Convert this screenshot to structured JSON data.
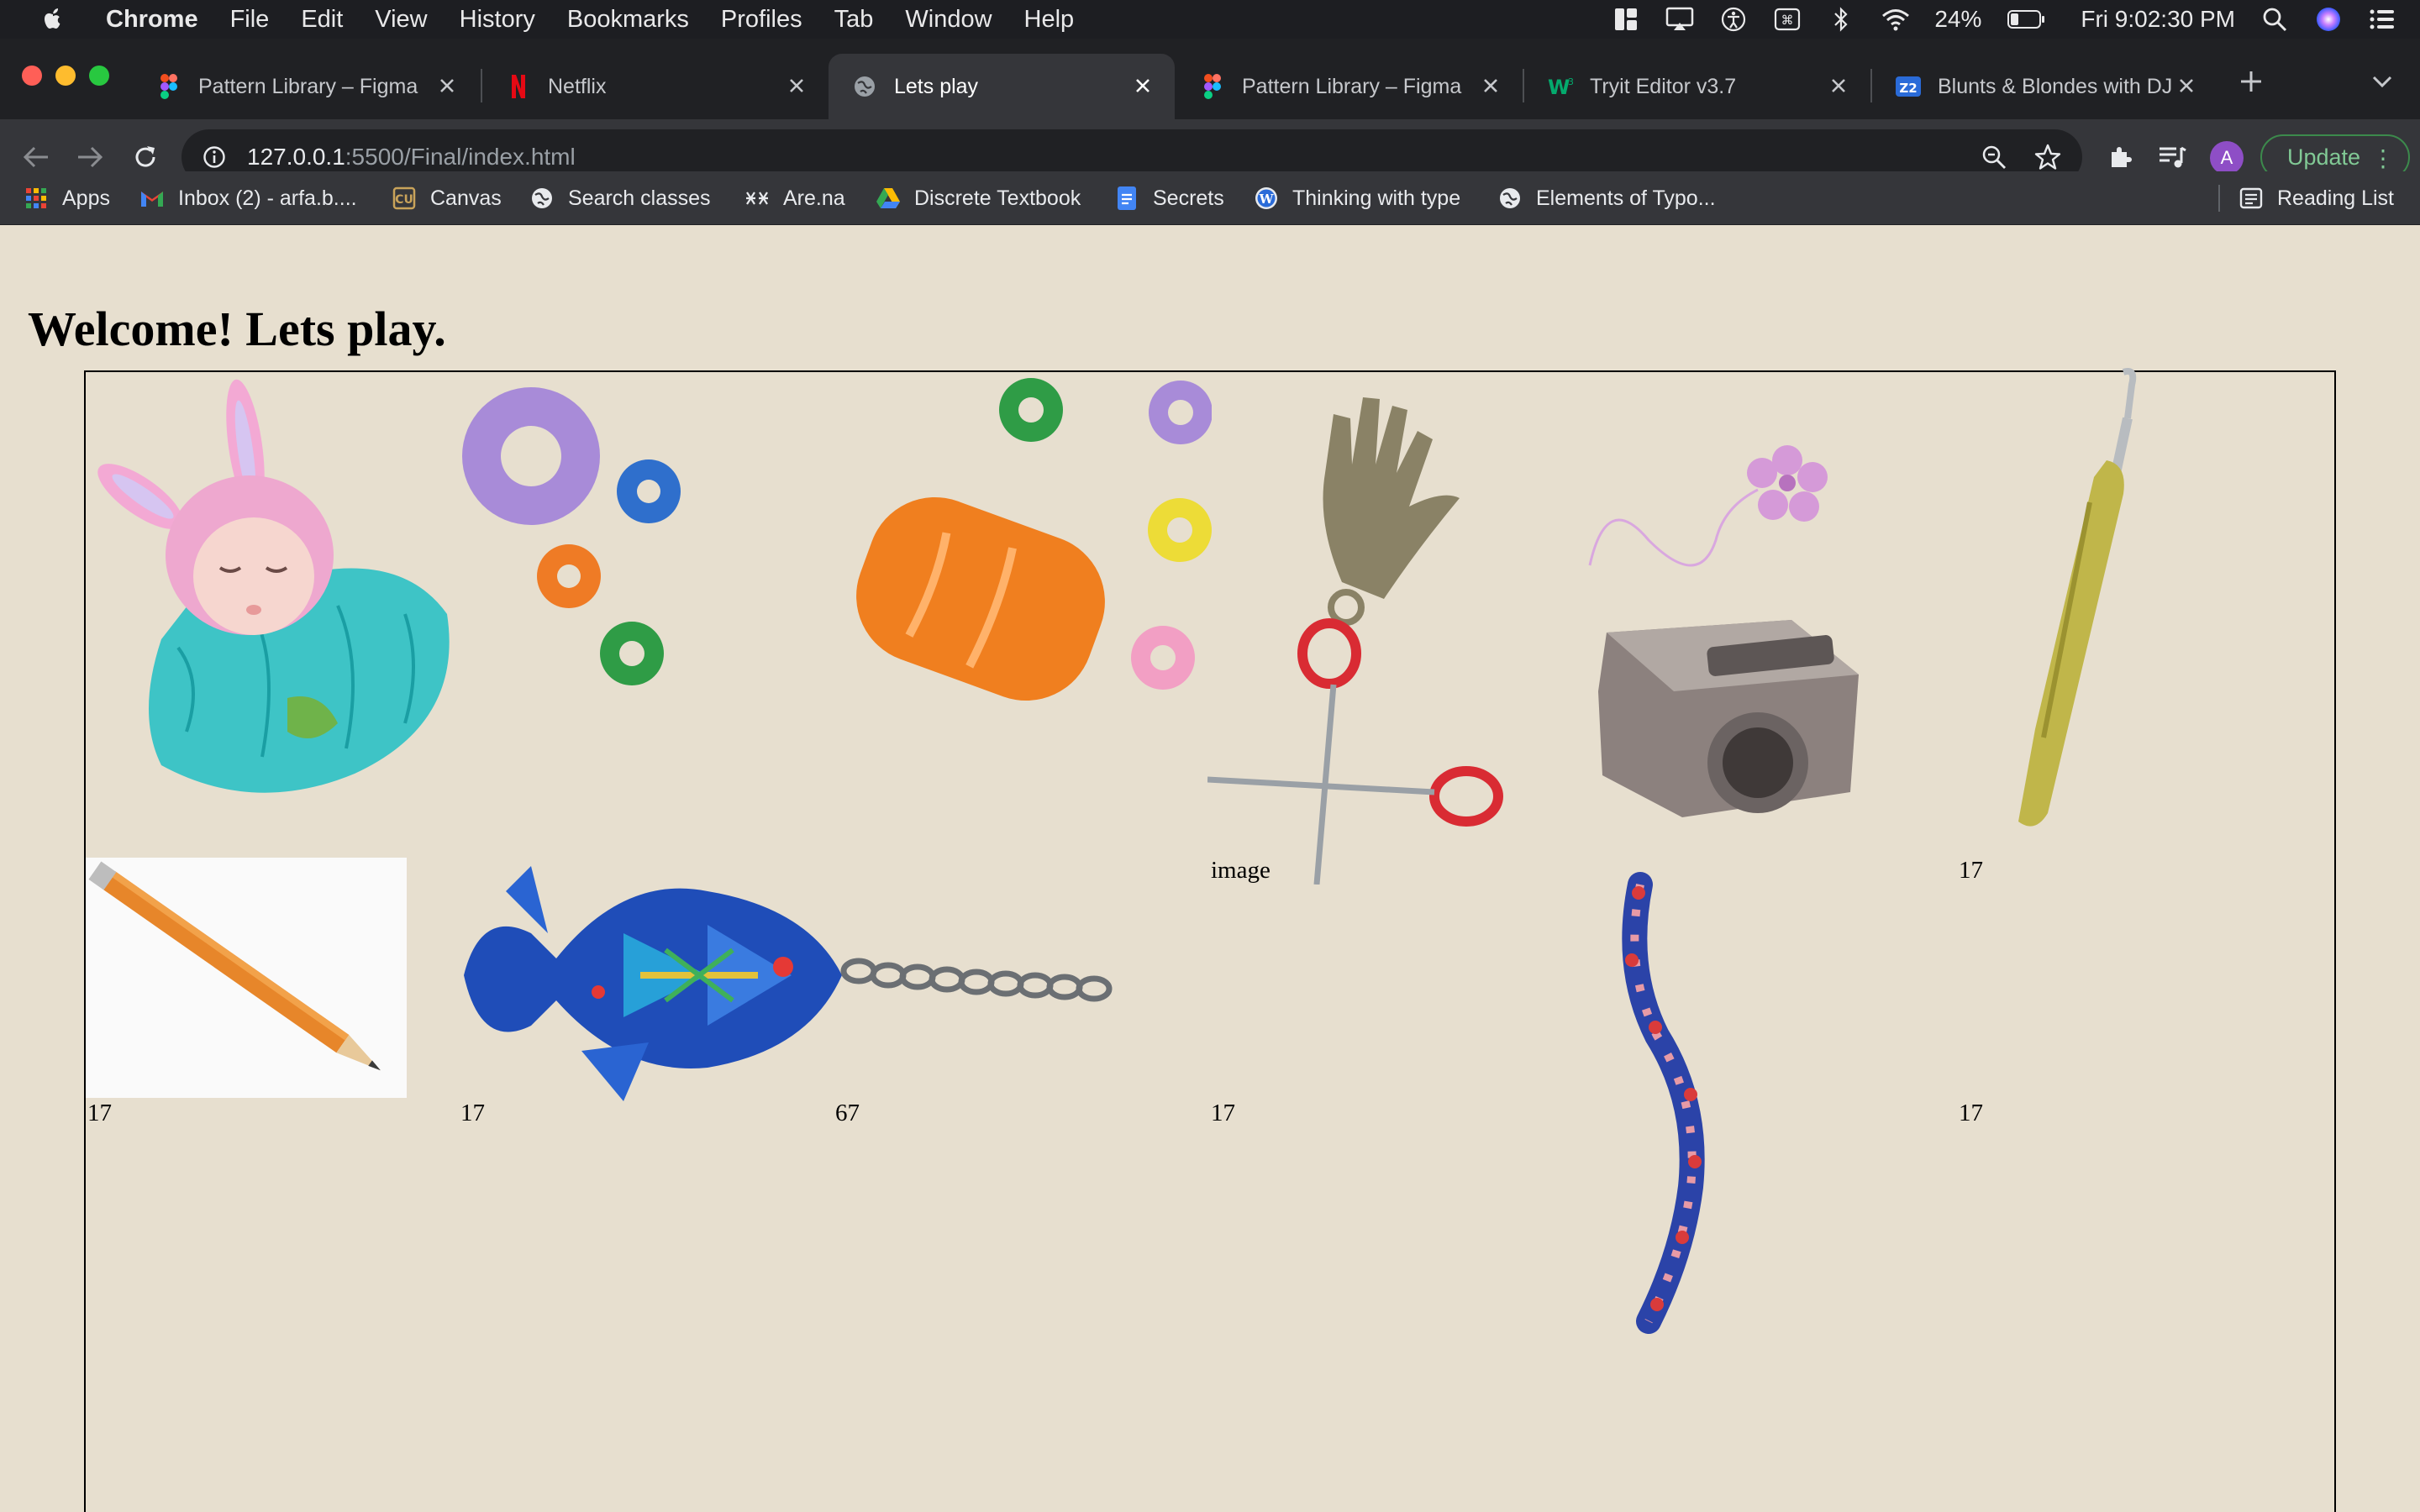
{
  "menubar": {
    "app": "Chrome",
    "items": [
      "File",
      "Edit",
      "View",
      "History",
      "Bookmarks",
      "Profiles",
      "Tab",
      "Window",
      "Help"
    ],
    "battery": "24%",
    "clock": "Fri 9:02:30 PM"
  },
  "tabs": [
    {
      "title": "Pattern Library – Figma",
      "icon": "figma-icon"
    },
    {
      "title": "Netflix",
      "icon": "netflix-icon"
    },
    {
      "title": "Lets play",
      "icon": "globe-icon",
      "active": true
    },
    {
      "title": "Pattern Library – Figma",
      "icon": "figma-icon"
    },
    {
      "title": "Tryit Editor v3.7",
      "icon": "w3schools-icon"
    },
    {
      "title": "Blunts & Blondes with DJ",
      "icon": "z2-icon"
    }
  ],
  "address": {
    "host": "127.0.0.1",
    "path": ":5500/Final/index.html"
  },
  "toolbar": {
    "profile_initial": "A",
    "update_label": "Update"
  },
  "bookmarks": [
    {
      "label": "Apps",
      "icon": "apps-grid-icon"
    },
    {
      "label": "Inbox (2) - arfa.b....",
      "icon": "gmail-icon"
    },
    {
      "label": "Canvas",
      "icon": "canvas-icon"
    },
    {
      "label": "Search classes",
      "icon": "globe-icon"
    },
    {
      "label": "Are.na",
      "icon": "arena-icon"
    },
    {
      "label": "Discrete Textbook",
      "icon": "drive-icon"
    },
    {
      "label": "Secrets",
      "icon": "docs-icon"
    },
    {
      "label": "Thinking with type",
      "icon": "wordpress-icon"
    },
    {
      "label": "Elements of Typo...",
      "icon": "globe-icon"
    }
  ],
  "reading_list": "Reading List",
  "page": {
    "heading": "Welcome! Lets play.",
    "captions": {
      "scissors": "image",
      "crochet_hook": "17",
      "pencil": "17",
      "fish": "17",
      "fish_right": "67",
      "row2_col4": "17",
      "row2_col6": "17"
    }
  },
  "colors": {
    "page_bg": "#e7dfcf",
    "chrome_dark": "#202124",
    "chrome_toolbar": "#35363a",
    "update_green": "#81c995"
  }
}
